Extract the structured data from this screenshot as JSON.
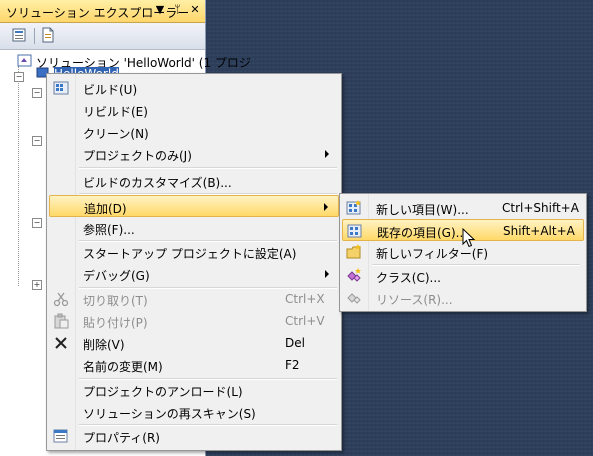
{
  "panel": {
    "title": "ソリューション エクスプローラー",
    "pin_glyph": "▼",
    "pushpin_glyph": "ᛘ",
    "close_glyph": "✕",
    "tree": {
      "solution_label": "ソリューション 'HelloWorld' (1 プロジ",
      "project_label": "HelloWorld"
    }
  },
  "context_menu": {
    "items": [
      {
        "label": "ビルド(U)",
        "icon": "build-icon"
      },
      {
        "label": "リビルド(E)"
      },
      {
        "label": "クリーン(N)"
      },
      {
        "label": "プロジェクトのみ(J)",
        "submenu": true
      },
      {
        "label": "ビルドのカスタマイズ(B)..."
      },
      {
        "label": "追加(D)",
        "submenu": true,
        "highlighted": true
      },
      {
        "label": "参照(F)..."
      },
      {
        "label": "スタートアップ プロジェクトに設定(A)"
      },
      {
        "label": "デバッグ(G)",
        "submenu": true
      },
      {
        "label": "切り取り(T)",
        "shortcut": "Ctrl+X",
        "disabled": true,
        "icon": "scissors-icon"
      },
      {
        "label": "貼り付け(P)",
        "shortcut": "Ctrl+V",
        "disabled": true,
        "icon": "paste-icon"
      },
      {
        "label": "削除(V)",
        "shortcut": "Del",
        "icon": "delete-x-icon"
      },
      {
        "label": "名前の変更(M)",
        "shortcut": "F2"
      },
      {
        "label": "プロジェクトのアンロード(L)"
      },
      {
        "label": "ソリューションの再スキャン(S)"
      },
      {
        "label": "プロパティ(R)",
        "icon": "properties-icon"
      }
    ]
  },
  "add_submenu": {
    "items": [
      {
        "label": "新しい項目(W)...",
        "shortcut": "Ctrl+Shift+A",
        "icon": "new-item-icon"
      },
      {
        "label": "既存の項目(G)...",
        "shortcut": "Shift+Alt+A",
        "icon": "existing-item-icon",
        "highlighted": true
      },
      {
        "label": "新しいフィルター(F)",
        "icon": "new-folder-icon"
      },
      {
        "label": "クラス(C)...",
        "icon": "class-icon"
      },
      {
        "label": "リソース(R)...",
        "icon": "resource-icon",
        "disabled": true
      }
    ]
  },
  "colors": {
    "highlight_top": "#fff3c4",
    "highlight_bottom": "#ffd969",
    "background": "#2d3e5b"
  }
}
